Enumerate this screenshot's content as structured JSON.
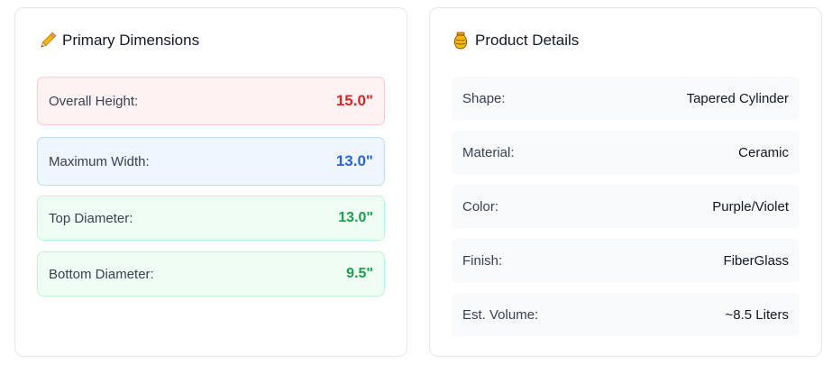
{
  "primary_dimensions": {
    "title": "Primary Dimensions",
    "icon": "ruler-pencil-icon",
    "rows": [
      {
        "label": "Overall Height:",
        "value": "15.0\"",
        "color": "#dc2626"
      },
      {
        "label": "Maximum Width:",
        "value": "13.0\"",
        "color": "#2563eb"
      },
      {
        "label": "Top Diameter:",
        "value": "13.0\"",
        "color": "#16a34a"
      },
      {
        "label": "Bottom Diameter:",
        "value": "9.5\"",
        "color": "#16a34a"
      }
    ]
  },
  "product_details": {
    "title": "Product Details",
    "icon": "vase-icon",
    "rows": [
      {
        "label": "Shape:",
        "value": "Tapered Cylinder"
      },
      {
        "label": "Material:",
        "value": "Ceramic"
      },
      {
        "label": "Color:",
        "value": "Purple/Violet"
      },
      {
        "label": "Finish:",
        "value": "FiberGlass"
      },
      {
        "label": "Est. Volume:",
        "value": "~8.5 Liters"
      }
    ]
  }
}
